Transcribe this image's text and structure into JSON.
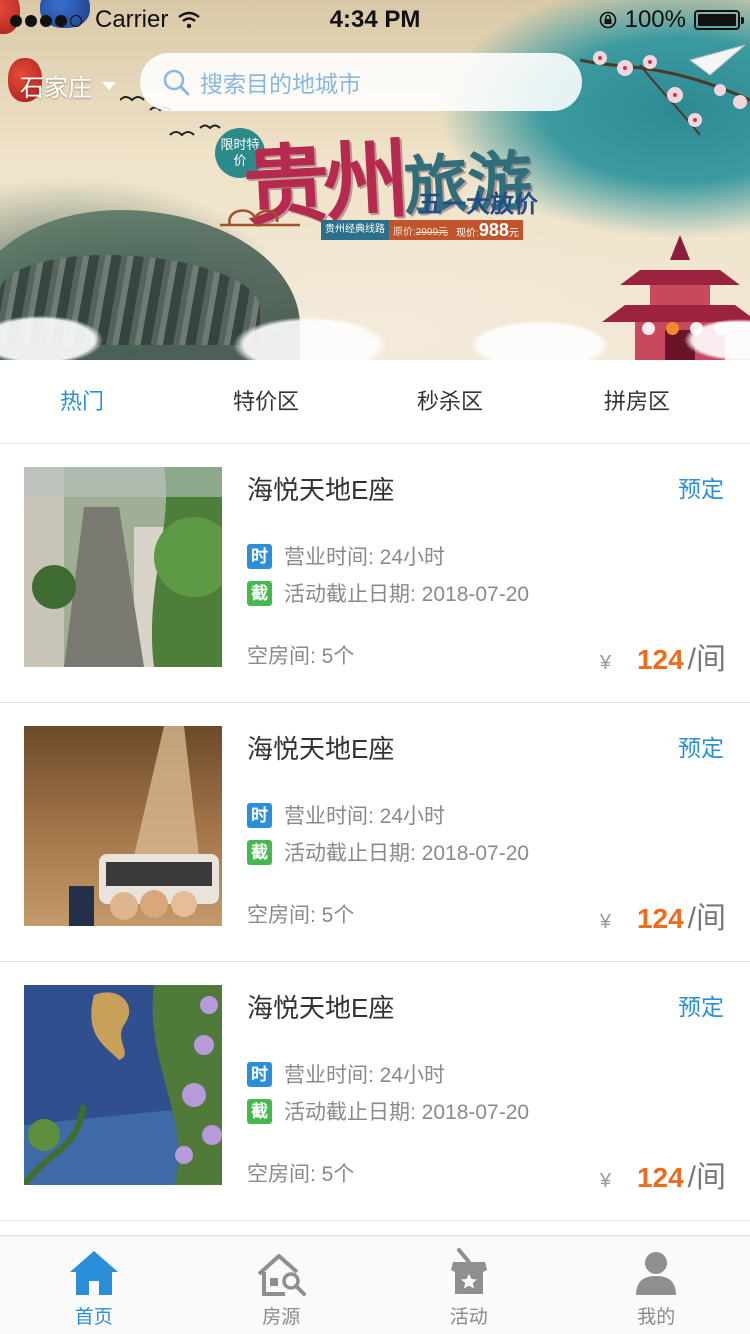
{
  "status_bar": {
    "carrier": "Carrier",
    "time": "4:34 PM",
    "battery": "100%"
  },
  "header": {
    "city": "石家庄",
    "search_placeholder": "搜索目的地城市"
  },
  "banner": {
    "badge": "限时特价",
    "title_part1": "贵州",
    "title_part2": "旅游",
    "subtitle": "五一大放价",
    "route_label": "贵州经典线路",
    "original_price_label": "原价:",
    "original_price": "2999元",
    "current_price_label": "现价:",
    "current_price": "988",
    "current_price_unit": "元",
    "pages": 4,
    "active_page": 2
  },
  "tabs": [
    {
      "label": "热门",
      "active": true
    },
    {
      "label": "特价区",
      "active": false
    },
    {
      "label": "秒杀区",
      "active": false
    },
    {
      "label": "拼房区",
      "active": false
    }
  ],
  "listings": [
    {
      "name": "海悦天地E座",
      "action": "预定",
      "hours_tag": "时",
      "hours_text": "营业时间: 24小时",
      "deadline_tag": "截",
      "deadline_text": "活动截止日期: 2018-07-20",
      "rooms_text": "空房间: 5个",
      "currency": "¥",
      "price": "124",
      "unit": "/间"
    },
    {
      "name": "海悦天地E座",
      "action": "预定",
      "hours_tag": "时",
      "hours_text": "营业时间: 24小时",
      "deadline_tag": "截",
      "deadline_text": "活动截止日期: 2018-07-20",
      "rooms_text": "空房间: 5个",
      "currency": "¥",
      "price": "124",
      "unit": "/间"
    },
    {
      "name": "海悦天地E座",
      "action": "预定",
      "hours_tag": "时",
      "hours_text": "营业时间: 24小时",
      "deadline_tag": "截",
      "deadline_text": "活动截止日期: 2018-07-20",
      "rooms_text": "空房间: 5个",
      "currency": "¥",
      "price": "124",
      "unit": "/间"
    }
  ],
  "tabbar": [
    {
      "label": "首页",
      "icon": "home-icon",
      "active": true
    },
    {
      "label": "房源",
      "icon": "house-search-icon",
      "active": false
    },
    {
      "label": "活动",
      "icon": "activity-bag-icon",
      "active": false
    },
    {
      "label": "我的",
      "icon": "user-icon",
      "active": false
    }
  ],
  "colors": {
    "accent": "#2a8fd8",
    "price": "#f06a1c",
    "tag_blue": "#2a8fd8",
    "tag_green": "#46b94e",
    "pager_active": "#f08a2a"
  }
}
